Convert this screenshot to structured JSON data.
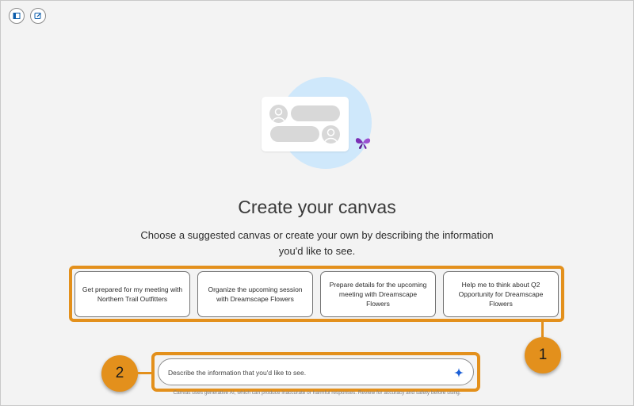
{
  "toolbar": {
    "sidebar_icon": "sidebar-toggle-icon",
    "new_icon": "new-canvas-icon"
  },
  "hero": {
    "illustration": "canvas-illustration",
    "mascot_icon": "butterfly-icon"
  },
  "page": {
    "title": "Create your canvas",
    "subtitle": "Choose a suggested canvas or create your own by describing the information you'd like to see."
  },
  "suggestions": [
    {
      "label": "Get prepared for my meeting with Northern Trail Outfitters"
    },
    {
      "label": "Organize the upcoming session with Dreamscape Flowers"
    },
    {
      "label": "Prepare details for the upcoming meeting with Dreamscape Flowers"
    },
    {
      "label": "Help me to think about Q2 Opportunity for Dreamscape Flowers"
    }
  ],
  "prompt": {
    "placeholder": "Describe the information that you'd like to see.",
    "submit_icon": "sparkle-icon"
  },
  "disclaimer": "Canvas uses generative AI, which can produce inaccurate or harmful responses. Review for accuracy and safety before using.",
  "callouts": {
    "one": "1",
    "two": "2"
  },
  "colors": {
    "callout": "#e3901c",
    "hero_circle": "#cfe8fb",
    "accent": "#0b5cab"
  }
}
